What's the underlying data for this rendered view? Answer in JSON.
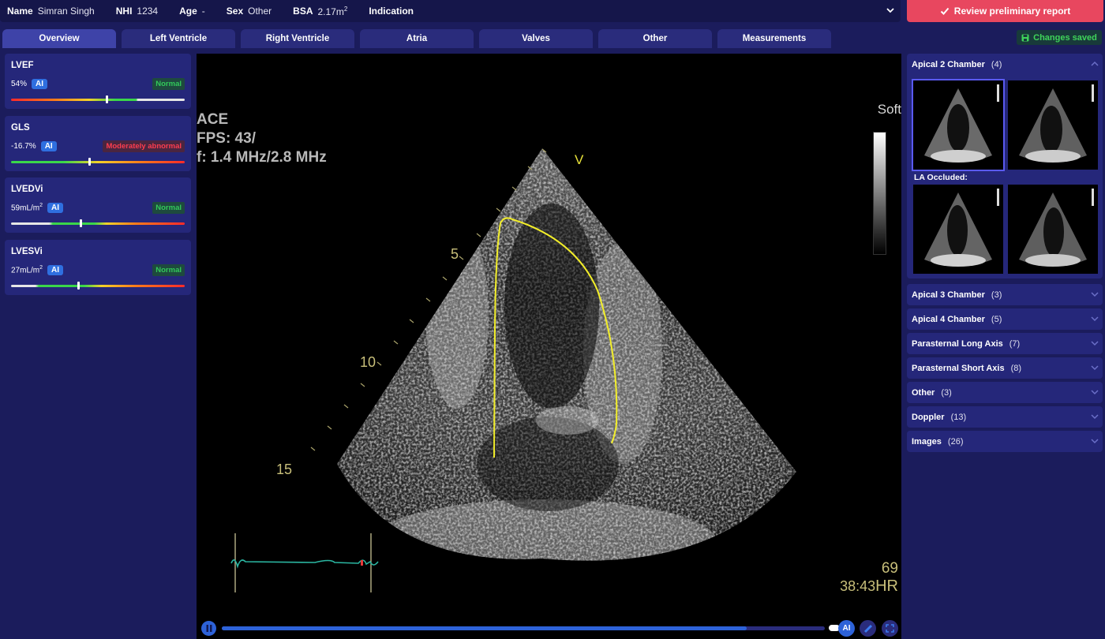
{
  "header": {
    "name_label": "Name",
    "name_value": "Simran Singh",
    "nhi_label": "NHI",
    "nhi_value": "1234",
    "age_label": "Age",
    "age_value": "-",
    "sex_label": "Sex",
    "sex_value": "Other",
    "bsa_label": "BSA",
    "bsa_value": "2.17m",
    "bsa_unit_sup": "2",
    "indication_label": "Indication"
  },
  "review_button": {
    "label": "Review preliminary report"
  },
  "tabs": [
    "Overview",
    "Left Ventricle",
    "Right Ventricle",
    "Atria",
    "Valves",
    "Other",
    "Measurements"
  ],
  "active_tab": "Overview",
  "save_status": "Changes saved",
  "metrics": [
    {
      "title": "LVEF",
      "value": "54%",
      "unit_sup": "",
      "ai": "AI",
      "status": "Normal",
      "status_kind": "normal",
      "marker_fraction": 0.55
    },
    {
      "title": "GLS",
      "value": "-16.7%",
      "unit_sup": "",
      "ai": "AI",
      "status": "Moderately abnormal",
      "status_kind": "abnormal",
      "marker_fraction": 0.45
    },
    {
      "title": "LVEDVi",
      "value": "59mL/m",
      "unit_sup": "2",
      "ai": "AI",
      "status": "Normal",
      "status_kind": "normal",
      "marker_fraction": 0.4
    },
    {
      "title": "LVESVi",
      "value": "27mL/m",
      "unit_sup": "2",
      "ai": "AI",
      "status": "Normal",
      "status_kind": "normal",
      "marker_fraction": 0.39
    }
  ],
  "viewer": {
    "overlay_line1": "ACE",
    "overlay_line2": "FPS: 43/",
    "overlay_line3": "f: 1.4 MHz/2.8 MHz",
    "soft_label": "Soft",
    "probe_marker": "V",
    "depth_5": "5",
    "depth_10": "10",
    "depth_15": "15",
    "heart_rate": "69",
    "hr_time": "38:43",
    "hr_label": "HR"
  },
  "player": {
    "progress": 0.87,
    "ai_label": "AI"
  },
  "views_panel": {
    "open_section": {
      "name": "Apical 2 Chamber",
      "count": "(4)",
      "sublabel": "LA Occluded:"
    },
    "sections": [
      {
        "name": "Apical 3 Chamber",
        "count": "(3)"
      },
      {
        "name": "Apical 4 Chamber",
        "count": "(5)"
      },
      {
        "name": "Parasternal Long Axis",
        "count": "(7)"
      },
      {
        "name": "Parasternal Short Axis",
        "count": "(8)"
      },
      {
        "name": "Other",
        "count": "(3)"
      },
      {
        "name": "Doppler",
        "count": "(13)"
      },
      {
        "name": "Images",
        "count": "(26)"
      }
    ]
  },
  "colors": {
    "background": "#1b1c5c",
    "card": "#25277a",
    "accent_blue": "#2d62d8",
    "review_red": "#e8475f",
    "normal_green": "#32c95a",
    "abnormal_red": "#ff3d4f",
    "trace_yellow": "#f2ee2a"
  }
}
